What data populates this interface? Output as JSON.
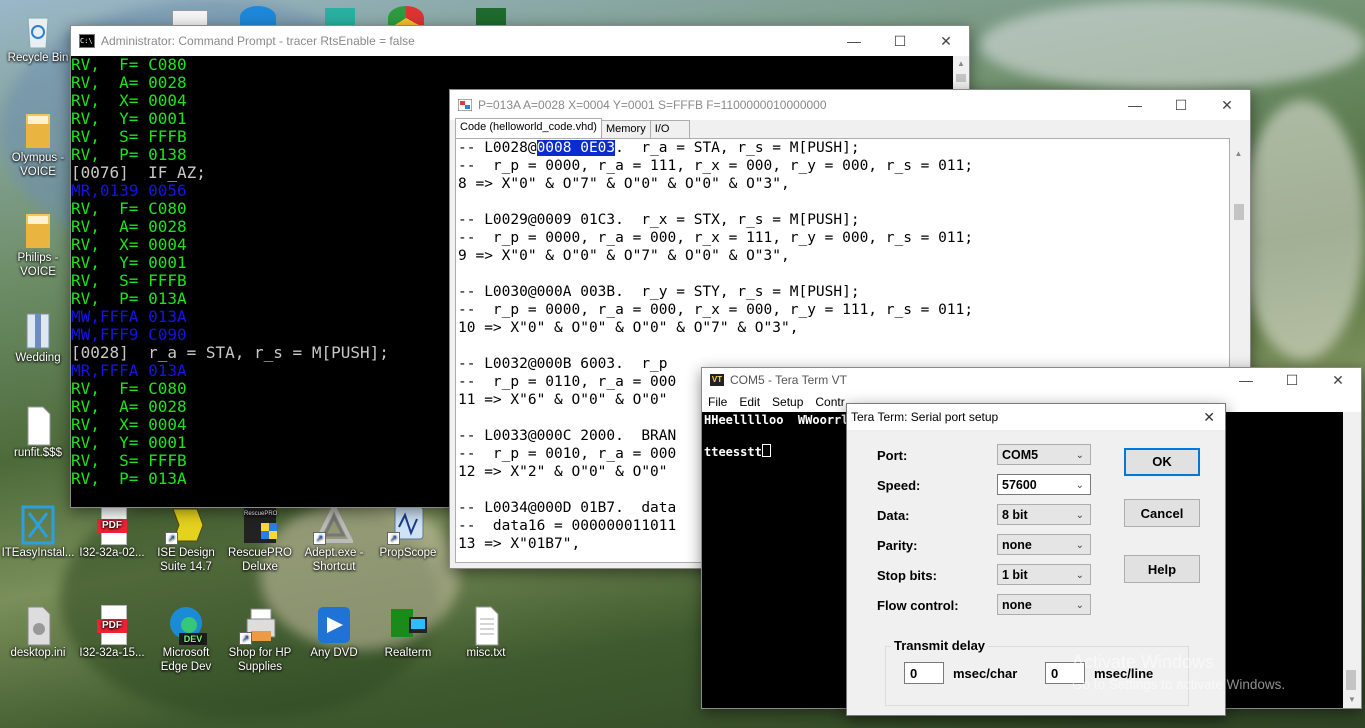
{
  "desktop": {
    "icons": [
      {
        "label": "Recycle Bin"
      },
      {
        "label": "Olympus - VOICE"
      },
      {
        "label": "Philips - VOICE"
      },
      {
        "label": "Wedding"
      },
      {
        "label": "runfit.$$$"
      },
      {
        "label": "ITEasyInstal..."
      },
      {
        "label": "I32-32a-02..."
      },
      {
        "label": "ISE Design Suite 14.7"
      },
      {
        "label": "RescuePRO Deluxe"
      },
      {
        "label": "Adept.exe - Shortcut"
      },
      {
        "label": "PropScope"
      },
      {
        "label": "desktop.ini"
      },
      {
        "label": "I32-32a-15..."
      },
      {
        "label": "Microsoft Edge Dev"
      },
      {
        "label": "Shop for HP Supplies"
      },
      {
        "label": "Any DVD"
      },
      {
        "label": "Realterm"
      },
      {
        "label": "misc.txt"
      }
    ],
    "icon_texts": {
      "pdf": "PDF",
      "dev": "DEV",
      "rescue": "RescuePRO"
    }
  },
  "cmd": {
    "title": "Administrator: Command Prompt - tracer RtsEnable = false",
    "lines": [
      {
        "text": "RV,  F= C080",
        "color": "#19e619"
      },
      {
        "text": "RV,  A= 0028",
        "color": "#19e619"
      },
      {
        "text": "RV,  X= 0004",
        "color": "#19e619"
      },
      {
        "text": "RV,  Y= 0001",
        "color": "#19e619"
      },
      {
        "text": "RV,  S= FFFB",
        "color": "#19e619"
      },
      {
        "text": "RV,  P= 0138",
        "color": "#19e619"
      },
      {
        "text": "[0076]  IF_AZ;",
        "color": "#c8c8c8"
      },
      {
        "text": "MR,0139 0056",
        "color": "#1414e6"
      },
      {
        "text": "RV,  F= C080",
        "color": "#19e619"
      },
      {
        "text": "RV,  A= 0028",
        "color": "#19e619"
      },
      {
        "text": "RV,  X= 0004",
        "color": "#19e619"
      },
      {
        "text": "RV,  Y= 0001",
        "color": "#19e619"
      },
      {
        "text": "RV,  S= FFFB",
        "color": "#19e619"
      },
      {
        "text": "RV,  P= 013A",
        "color": "#19e619"
      },
      {
        "text": "MW,FFFA 013A",
        "color": "#1414e6"
      },
      {
        "text": "MW,FFF9 C090",
        "color": "#1414e6"
      },
      {
        "text": "[0028]  r_a = STA, r_s = M[PUSH];",
        "color": "#c8c8c8"
      },
      {
        "text": "MR,FFFA 013A",
        "color": "#1414e6"
      },
      {
        "text": "RV,  F= C080",
        "color": "#19e619"
      },
      {
        "text": "RV,  A= 0028",
        "color": "#19e619"
      },
      {
        "text": "RV,  X= 0004",
        "color": "#19e619"
      },
      {
        "text": "RV,  Y= 0001",
        "color": "#19e619"
      },
      {
        "text": "RV,  S= FFFB",
        "color": "#19e619"
      },
      {
        "text": "RV,  P= 013A",
        "color": "#19e619"
      }
    ]
  },
  "tracer": {
    "title": "P=013A A=0028 X=0004 Y=0001 S=FFFB F=1100000010000000",
    "tabs": [
      {
        "label": "Code (helloworld_code.vhd)",
        "active": true
      },
      {
        "label": "Memory",
        "active": false
      },
      {
        "label": "I/O",
        "active": false
      }
    ],
    "first_line": {
      "prefix": "-- L0028@",
      "selected": "0008 0E03",
      "suffix": ".  r_a = STA, r_s = M[PUSH];"
    },
    "lines": [
      "--  r_p = 0000, r_a = 111, r_x = 000, r_y = 000, r_s = 011;",
      "8 => X\"0\" & O\"7\" & O\"0\" & O\"0\" & O\"3\",",
      "",
      "-- L0029@0009 01C3.  r_x = STX, r_s = M[PUSH];",
      "--  r_p = 0000, r_a = 000, r_x = 111, r_y = 000, r_s = 011;",
      "9 => X\"0\" & O\"0\" & O\"7\" & O\"0\" & O\"3\",",
      "",
      "-- L0030@000A 003B.  r_y = STY, r_s = M[PUSH];",
      "--  r_p = 0000, r_a = 000, r_x = 000, r_y = 111, r_s = 011;",
      "10 => X\"0\" & O\"0\" & O\"0\" & O\"7\" & O\"3\",",
      "",
      "-- L0032@000B 6003.  r_p",
      "--  r_p = 0110, r_a = 000",
      "11 => X\"6\" & O\"0\" & O\"0\"",
      "",
      "-- L0033@000C 2000.  BRAN",
      "--  r_p = 0010, r_a = 000",
      "12 => X\"2\" & O\"0\" & O\"0\"",
      "",
      "-- L0034@000D 01B7.  data",
      "--  data16 = 000000011011",
      "13 => X\"01B7\","
    ]
  },
  "teraterm": {
    "title": "COM5 - Tera Term VT",
    "menu": [
      "File",
      "Edit",
      "Setup",
      "Contr"
    ],
    "lines": [
      "HHeellllloo  WWoorrl",
      "",
      "tteesstt"
    ]
  },
  "serial_dialog": {
    "title": "Tera Term: Serial port setup",
    "fields": [
      {
        "label": "Port:",
        "value": "COM5"
      },
      {
        "label": "Speed:",
        "value": "57600"
      },
      {
        "label": "Data:",
        "value": "8 bit"
      },
      {
        "label": "Parity:",
        "value": "none"
      },
      {
        "label": "Stop bits:",
        "value": "1 bit"
      },
      {
        "label": "Flow control:",
        "value": "none"
      }
    ],
    "buttons": {
      "ok": "OK",
      "cancel": "Cancel",
      "help": "Help"
    },
    "transmit_delay": {
      "label": "Transmit delay",
      "char_value": "0",
      "char_unit": "msec/char",
      "line_value": "0",
      "line_unit": "msec/line"
    }
  },
  "watermark": {
    "title": "Activate Windows",
    "subtitle": "Go to Settings to activate Windows."
  }
}
